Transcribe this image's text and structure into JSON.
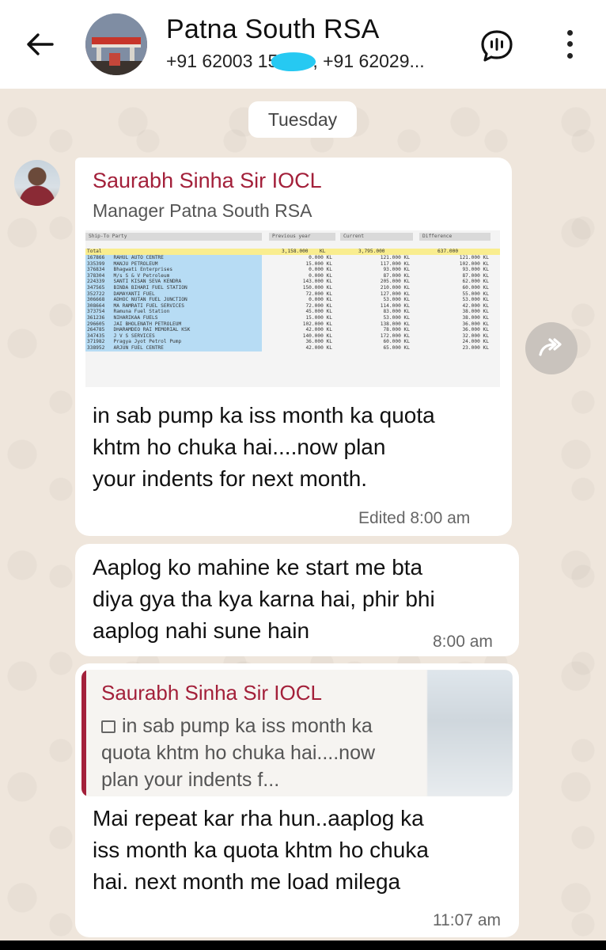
{
  "header": {
    "title": "Patna South RSA",
    "participants_prefix": "+91 62003 15",
    "participants_suffix": ", +91 62029..."
  },
  "date_divider": "Tuesday",
  "messages": [
    {
      "sender": "Saurabh Sinha Sir IOCL",
      "sender_role": "Manager Patna South RSA",
      "image_table": {
        "headers": [
          "Ship-To Party",
          "Previous year",
          "Current",
          "Difference"
        ],
        "total": {
          "label": "Total",
          "previous": "3,158.000",
          "current": "3,795.000",
          "difference": "637.000",
          "unit": "KL"
        },
        "rows": [
          {
            "code": "167866",
            "name": "RAHUL AUTO CENTRE",
            "previous": "0.000",
            "current": "121.000",
            "difference": "121.000"
          },
          {
            "code": "335399",
            "name": "MANJU PETROLEUM",
            "previous": "15.000",
            "current": "117.000",
            "difference": "102.000"
          },
          {
            "code": "376834",
            "name": "Bhagwati Enterprises",
            "previous": "0.000",
            "current": "93.000",
            "difference": "93.000"
          },
          {
            "code": "378304",
            "name": "M/s S & V Petroleum",
            "previous": "0.000",
            "current": "87.000",
            "difference": "87.000"
          },
          {
            "code": "224339",
            "name": "SANTI KISAN SEVA KENDRA",
            "previous": "143.000",
            "current": "205.000",
            "difference": "62.000"
          },
          {
            "code": "347565",
            "name": "BINDA BIHARI FUEL STATION",
            "previous": "150.000",
            "current": "210.000",
            "difference": "60.000"
          },
          {
            "code": "352722",
            "name": "DAMAYANTI FUEL",
            "previous": "72.000",
            "current": "127.000",
            "difference": "55.000"
          },
          {
            "code": "306668",
            "name": "ADHOC NUTAN FUEL JUNCTION",
            "previous": "0.000",
            "current": "53.000",
            "difference": "53.000"
          },
          {
            "code": "308664",
            "name": "MA RAMRATI FUEL SERVICES",
            "previous": "72.000",
            "current": "114.000",
            "difference": "42.000"
          },
          {
            "code": "373754",
            "name": "Ramuna Fuel Station",
            "previous": "45.000",
            "current": "83.000",
            "difference": "38.000"
          },
          {
            "code": "361236",
            "name": "NIHARIKAA FUELS",
            "previous": "15.000",
            "current": "53.000",
            "difference": "38.000"
          },
          {
            "code": "296605",
            "name": "JAI BHOLENATH PETROLEUM",
            "previous": "102.000",
            "current": "138.000",
            "difference": "36.000"
          },
          {
            "code": "264785",
            "name": "DHARAMDEO RAI MEMORIAL KSK",
            "previous": "42.000",
            "current": "78.000",
            "difference": "36.000"
          },
          {
            "code": "347435",
            "name": "J V S SERVICES",
            "previous": "140.000",
            "current": "172.000",
            "difference": "32.000"
          },
          {
            "code": "371982",
            "name": "Pragya Jyot Petrol Pump",
            "previous": "36.000",
            "current": "60.000",
            "difference": "24.000"
          },
          {
            "code": "338952",
            "name": "ARJUN FUEL CENTRE",
            "previous": "42.000",
            "current": "65.000",
            "difference": "23.000"
          }
        ]
      },
      "text": "in sab pump ka iss month ka quota\nkhtm ho chuka hai....now plan\nyour indents for next month.",
      "meta": "Edited  8:00 am"
    },
    {
      "text": "Aaplog ko mahine ke start me bta\ndiya gya tha kya karna hai, phir bhi\naaplog nahi sune hain",
      "meta": "8:00 am"
    },
    {
      "quoted_sender": "Saurabh Sinha Sir IOCL",
      "quoted_text": "in sab pump ka iss month ka quota khtm ho chuka hai....now plan your indents f...",
      "text": "Mai repeat kar rha hun..aaplog ka\niss month ka quota khtm ho chuka\nhai. next month me load milega",
      "meta": "11:07 am"
    }
  ],
  "unit_label": "KL",
  "colors": {
    "accent": "#a3203a",
    "chat_bg": "#efe6dc",
    "bubble": "#ffffff"
  }
}
